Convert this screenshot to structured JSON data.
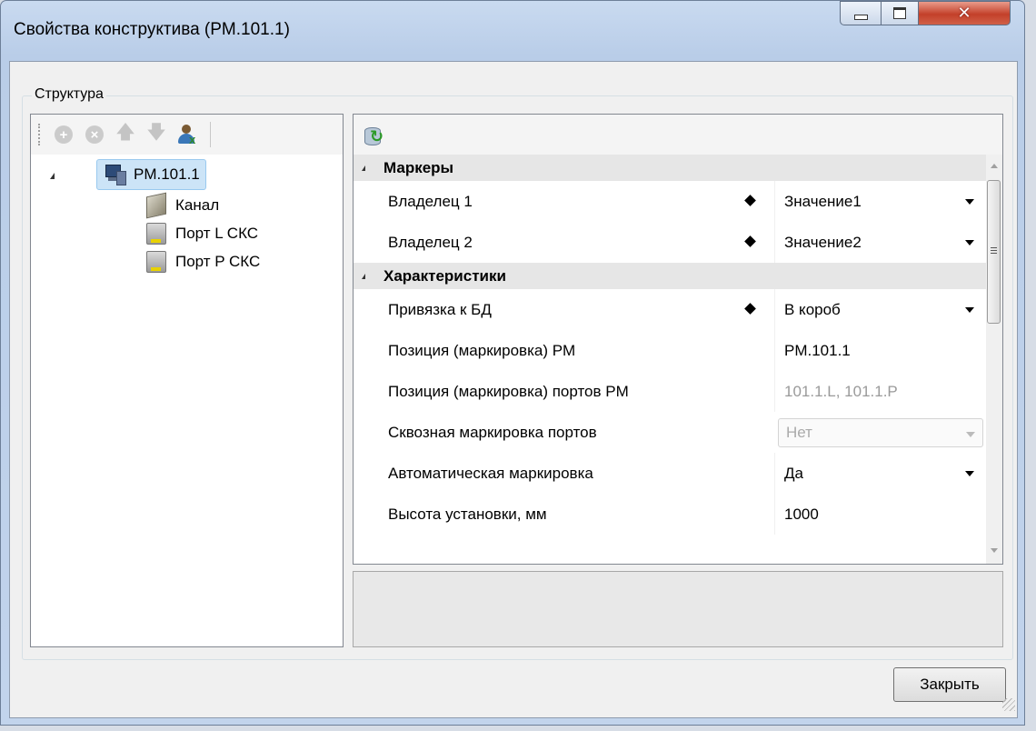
{
  "window": {
    "title": "Свойства конструктива (PM.101.1)"
  },
  "group": {
    "label": "Структура"
  },
  "tree_toolbar": {
    "buttons": [
      "add-icon",
      "remove-icon",
      "move-up-icon",
      "move-down-icon",
      "assign-user-icon"
    ]
  },
  "tree": {
    "root": {
      "label": "PM.101.1",
      "icon": "computer-icon"
    },
    "children": [
      {
        "label": "Канал",
        "icon": "channel-icon"
      },
      {
        "label": "Порт L СКС",
        "icon": "port-icon"
      },
      {
        "label": "Порт P СКС",
        "icon": "port-icon"
      }
    ]
  },
  "grid": {
    "categories": [
      {
        "name": "Маркеры",
        "props": [
          {
            "name": "Владелец 1",
            "value": "Значение1"
          },
          {
            "name": "Владелец 2",
            "value": "Значение2"
          }
        ]
      },
      {
        "name": "Характеристики",
        "props": [
          {
            "name": "Привязка к БД",
            "value": "В короб"
          },
          {
            "name": "Позиция (маркировка) PM",
            "value": "PM.101.1"
          },
          {
            "name": "Позиция (маркировка) портов PM",
            "value": "101.1.L, 101.1.P"
          },
          {
            "name": "Сквозная маркировка портов",
            "value": "Нет"
          },
          {
            "name": "Автоматическая маркировка",
            "value": "Да"
          },
          {
            "name": "Высота установки, мм",
            "value": "1000"
          }
        ]
      }
    ]
  },
  "buttons": {
    "close": "Закрыть"
  },
  "colors": {
    "selection": "#cce4f7",
    "category_bg": "#e6e6e6",
    "close_caption": "#c3402a"
  }
}
